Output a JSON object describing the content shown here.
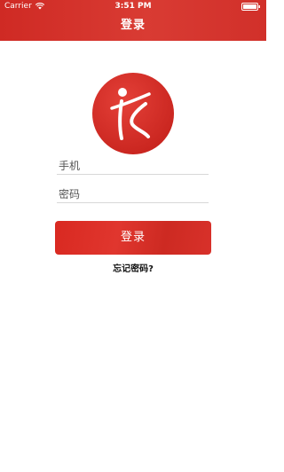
{
  "status_bar": {
    "carrier": "Carrier",
    "wifi_icon": "wifi-icon",
    "time": "3:51 PM",
    "battery_icon": "battery-icon"
  },
  "nav": {
    "title": "登录"
  },
  "logo": {
    "icon": "app-logo-icon",
    "color": "#d9322c"
  },
  "form": {
    "phone_placeholder": "手机",
    "phone_value": "",
    "password_placeholder": "密码",
    "password_value": ""
  },
  "actions": {
    "login_label": "登录",
    "forgot_password_label": "忘记密码?"
  },
  "colors": {
    "accent": "#d9322c",
    "header": "#d12d27"
  }
}
